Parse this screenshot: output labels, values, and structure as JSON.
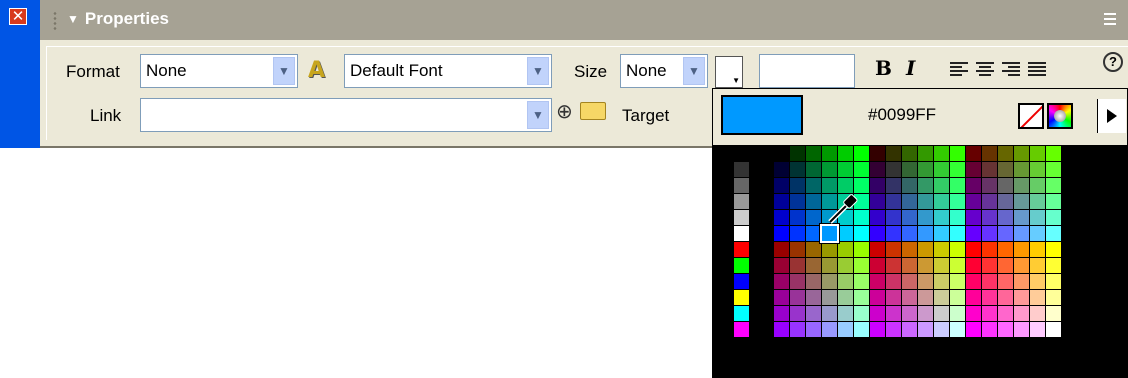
{
  "panel": {
    "title": "Properties",
    "format_label": "Format",
    "format_value": "None",
    "font_value": "Default Font",
    "size_label": "Size",
    "size_value": "None",
    "link_label": "Link",
    "link_value": "",
    "target_label": "Target"
  },
  "toolbar": {
    "bold": "B",
    "italic": "I",
    "help": "?"
  },
  "picker": {
    "current_color": "#0099FF",
    "hex_text": "#0099FF"
  },
  "icons": [
    "close-icon",
    "grip-icon",
    "collapse-triangle-icon",
    "panel-menu-icon",
    "font-a-icon",
    "chevron-down-icon",
    "align-left-icon",
    "align-center-icon",
    "align-right-icon",
    "align-justify-icon",
    "help-icon",
    "point-to-file-icon",
    "folder-icon",
    "no-color-icon",
    "color-wheel-icon",
    "picker-arrow-icon",
    "eyedropper-icon"
  ]
}
